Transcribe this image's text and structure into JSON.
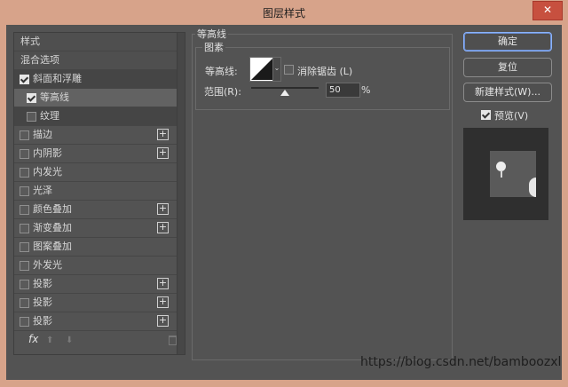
{
  "window": {
    "title": "图层样式",
    "close_symbol": "✕"
  },
  "left_panel": {
    "items": [
      {
        "label": "样式",
        "checkbox": false,
        "checked": false,
        "plus": false,
        "indent": 0,
        "style": "sec"
      },
      {
        "label": "混合选项",
        "checkbox": false,
        "checked": false,
        "plus": false,
        "indent": 0,
        "style": "sec"
      },
      {
        "label": "斜面和浮雕",
        "checkbox": true,
        "checked": true,
        "plus": false,
        "indent": 0,
        "style": "dark"
      },
      {
        "label": "等高线",
        "checkbox": true,
        "checked": true,
        "plus": false,
        "indent": 1,
        "style": "sel"
      },
      {
        "label": "纹理",
        "checkbox": true,
        "checked": false,
        "plus": false,
        "indent": 1,
        "style": "dark"
      },
      {
        "label": "描边",
        "checkbox": true,
        "checked": false,
        "plus": true,
        "indent": 0,
        "style": ""
      },
      {
        "label": "内阴影",
        "checkbox": true,
        "checked": false,
        "plus": true,
        "indent": 0,
        "style": ""
      },
      {
        "label": "内发光",
        "checkbox": true,
        "checked": false,
        "plus": false,
        "indent": 0,
        "style": ""
      },
      {
        "label": "光泽",
        "checkbox": true,
        "checked": false,
        "plus": false,
        "indent": 0,
        "style": ""
      },
      {
        "label": "颜色叠加",
        "checkbox": true,
        "checked": false,
        "plus": true,
        "indent": 0,
        "style": ""
      },
      {
        "label": "渐变叠加",
        "checkbox": true,
        "checked": false,
        "plus": true,
        "indent": 0,
        "style": ""
      },
      {
        "label": "图案叠加",
        "checkbox": true,
        "checked": false,
        "plus": false,
        "indent": 0,
        "style": ""
      },
      {
        "label": "外发光",
        "checkbox": true,
        "checked": false,
        "plus": false,
        "indent": 0,
        "style": ""
      },
      {
        "label": "投影",
        "checkbox": true,
        "checked": false,
        "plus": true,
        "indent": 0,
        "style": ""
      },
      {
        "label": "投影",
        "checkbox": true,
        "checked": false,
        "plus": true,
        "indent": 0,
        "style": ""
      },
      {
        "label": "投影",
        "checkbox": true,
        "checked": false,
        "plus": true,
        "indent": 0,
        "style": ""
      }
    ],
    "fx_label": "fx",
    "up_arrow": "⬆",
    "down_arrow": "⬇"
  },
  "contour": {
    "section_title": "等高线",
    "group_title": "图素",
    "contour_label": "等高线:",
    "antialias_label": "消除锯齿 (L)",
    "antialias_checked": false,
    "range_label": "范围(R):",
    "range_value": "50",
    "range_unit": "%",
    "range_fraction": 0.5,
    "dropdown_symbol": "⌄"
  },
  "buttons": {
    "ok": "确定",
    "reset": "复位",
    "new_style": "新建样式(W)...",
    "preview_label": "预览(V)",
    "preview_checked": true
  },
  "watermark": "https://blog.csdn.net/bamboozxl",
  "colors": {
    "titlebar": "#d7a38a",
    "panel": "#535353",
    "accent": "#8ab3ff"
  }
}
